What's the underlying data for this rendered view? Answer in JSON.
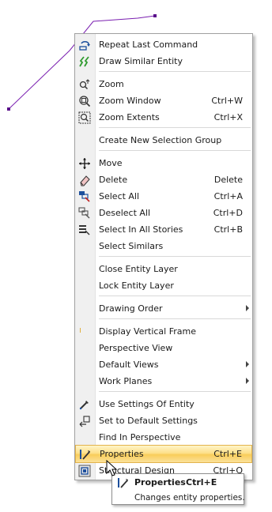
{
  "menu": {
    "items": [
      {
        "label": "Repeat Last Command",
        "shortcut": "",
        "icon": "repeat-icon"
      },
      {
        "label": "Draw Similar Entity",
        "shortcut": "",
        "icon": "draw-similar-icon"
      },
      {
        "label": "Zoom",
        "shortcut": "",
        "icon": "zoom-icon"
      },
      {
        "label": "Zoom Window",
        "shortcut": "Ctrl+W",
        "icon": "zoom-window-icon"
      },
      {
        "label": "Zoom Extents",
        "shortcut": "Ctrl+X",
        "icon": "zoom-extents-icon"
      },
      {
        "label": "Create New Selection Group",
        "shortcut": ""
      },
      {
        "label": "Move",
        "shortcut": "",
        "icon": "move-icon"
      },
      {
        "label": "Delete",
        "shortcut": "Delete",
        "icon": "eraser-icon"
      },
      {
        "label": "Select All",
        "shortcut": "Ctrl+A",
        "icon": "select-all-icon"
      },
      {
        "label": "Deselect All",
        "shortcut": "Ctrl+D",
        "icon": "deselect-all-icon"
      },
      {
        "label": "Select In All Stories",
        "shortcut": "Ctrl+B",
        "icon": "select-stories-icon"
      },
      {
        "label": "Select Similars",
        "shortcut": ""
      },
      {
        "label": "Close Entity Layer",
        "shortcut": ""
      },
      {
        "label": "Lock Entity Layer",
        "shortcut": ""
      },
      {
        "label": "Drawing Order",
        "shortcut": "",
        "submenu": true
      },
      {
        "label": "Display Vertical Frame",
        "shortcut": ""
      },
      {
        "label": "Perspective View",
        "shortcut": ""
      },
      {
        "label": "Default Views",
        "shortcut": "",
        "submenu": true
      },
      {
        "label": "Work Planes",
        "shortcut": "",
        "submenu": true
      },
      {
        "label": "Use Settings Of Entity",
        "shortcut": "",
        "icon": "eyedropper-icon"
      },
      {
        "label": "Set to Default Settings",
        "shortcut": "",
        "icon": "default-settings-icon"
      },
      {
        "label": "Find In Perspective",
        "shortcut": ""
      },
      {
        "label": "Properties",
        "shortcut": "Ctrl+E",
        "icon": "properties-icon",
        "highlighted": true
      },
      {
        "label": "Structural Design",
        "shortcut": "Ctrl+Q",
        "icon": "structural-design-icon"
      }
    ]
  },
  "tooltip": {
    "title": "Properties",
    "shortcut": "Ctrl+E",
    "description": "Changes entity properties."
  },
  "colors": {
    "highlight": "#fbe19a",
    "polyline": "#7a1fb0",
    "icon_blue": "#1d4f9c"
  }
}
